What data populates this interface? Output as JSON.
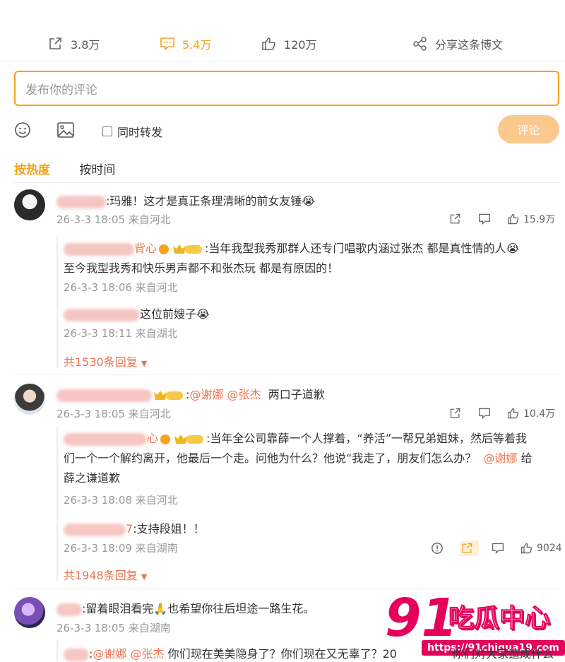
{
  "actions": {
    "repost_count": "3.8万",
    "comment_count": "5.4万",
    "like_count": "120万",
    "share_label": "分享这条博文"
  },
  "composer": {
    "placeholder": "发布你的评论",
    "repost_label": "同时转发",
    "submit_label": "评论"
  },
  "sort": {
    "hot": "按热度",
    "time": "按时间"
  },
  "comments": [
    {
      "text": ":玛雅！这才是真正条理清晰的前女友锤😭",
      "meta": "26-3-3 18:05 来自河北",
      "likes": "15.9万",
      "replies": [
        {
          "name_tail": "背心",
          "text1": ":当年我型我秀那群人还专门唱歌内涵过张杰  都是真性情的人😭",
          "text2": "至今我型我秀和快乐男声都不和张杰玩 都是有原因的！",
          "meta": "26-3-3 18:06 来自河北"
        },
        {
          "text": "这位前嫂子😭",
          "meta": "26-3-3 18:11 来自湖北"
        }
      ],
      "more": "共1530条回复"
    },
    {
      "mention1": "@谢娜",
      "mention2": "@张杰",
      "text": "两口子道歉",
      "meta": "26-3-3 18:05 来自河北",
      "likes": "10.4万",
      "replies": [
        {
          "name_tail": "心",
          "text1": ":当年全公司靠薛一个人撑着，“养活”一帮兄弟姐妹，然后等着我",
          "text2": "们一个一个解约离开，他最后一个走。问他为什么？他说“我走了，朋友们怎么办？",
          "mention": "@谢娜",
          "text2b": "给",
          "text3": "薛之谦道歉",
          "meta": "26-3-3 18:08 来自河北"
        },
        {
          "name_tail": "7",
          "text": ":支持段姐！！",
          "meta": "26-3-3 18:09 来自湖南",
          "likes": "9024"
        }
      ],
      "more": "共1948条回复"
    },
    {
      "text": ":留着眼泪看完🙏也希望你往后坦途一路生花。",
      "meta": "26-3-3 18:05 来自湖南",
      "reply_mention1": "@谢娜",
      "reply_mention2": "@张杰",
      "reply_text": "你们现在美美隐身了？你们现在又无辜了？20",
      "reply_text_tail": "你们对大家造成什么"
    }
  ],
  "watermark": {
    "num": "91",
    "brand": "吃瓜中心",
    "url": "https://91chigua19.com"
  }
}
